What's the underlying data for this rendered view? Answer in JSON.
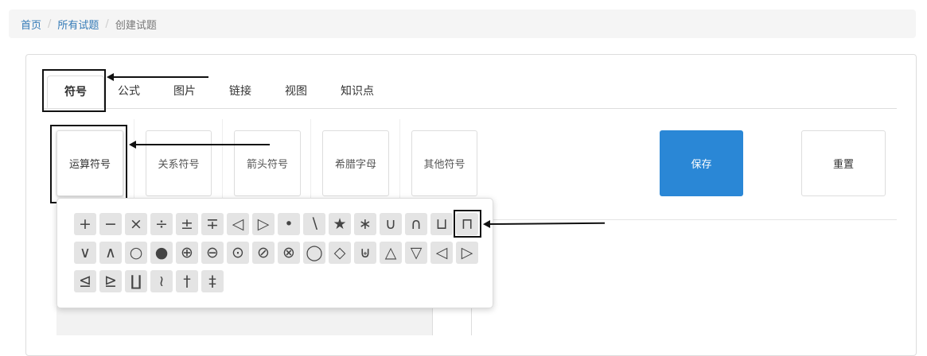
{
  "breadcrumb": {
    "home": "首页",
    "all": "所有试题",
    "current": "创建试题",
    "sep": "/"
  },
  "tabs": [
    {
      "label": "符号"
    },
    {
      "label": "公式"
    },
    {
      "label": "图片"
    },
    {
      "label": "链接"
    },
    {
      "label": "视图"
    },
    {
      "label": "知识点"
    }
  ],
  "categories": [
    {
      "label": "运算符号"
    },
    {
      "label": "关系符号"
    },
    {
      "label": "箭头符号"
    },
    {
      "label": "希腊字母"
    },
    {
      "label": "其他符号"
    }
  ],
  "actions": {
    "save": "保存",
    "reset": "重置"
  },
  "symbols": {
    "row1": [
      "+",
      "−",
      "×",
      "÷",
      "±",
      "∓",
      "◁",
      "▷",
      "•",
      "∖",
      "★",
      "∗",
      "∪",
      "∩",
      "⊔",
      "⊓"
    ],
    "row2": [
      "∨",
      "∧",
      "○",
      "●",
      "⊕",
      "⊖",
      "⊙",
      "⊘",
      "⊗",
      "◯",
      "◇",
      "⊎",
      "△",
      "▽",
      "◁",
      "▷"
    ],
    "row3": [
      "⊴",
      "⊵",
      "∐",
      "≀",
      "†",
      "‡"
    ]
  },
  "colors": {
    "primary": "#2a87d6",
    "link": "#337ab7"
  }
}
